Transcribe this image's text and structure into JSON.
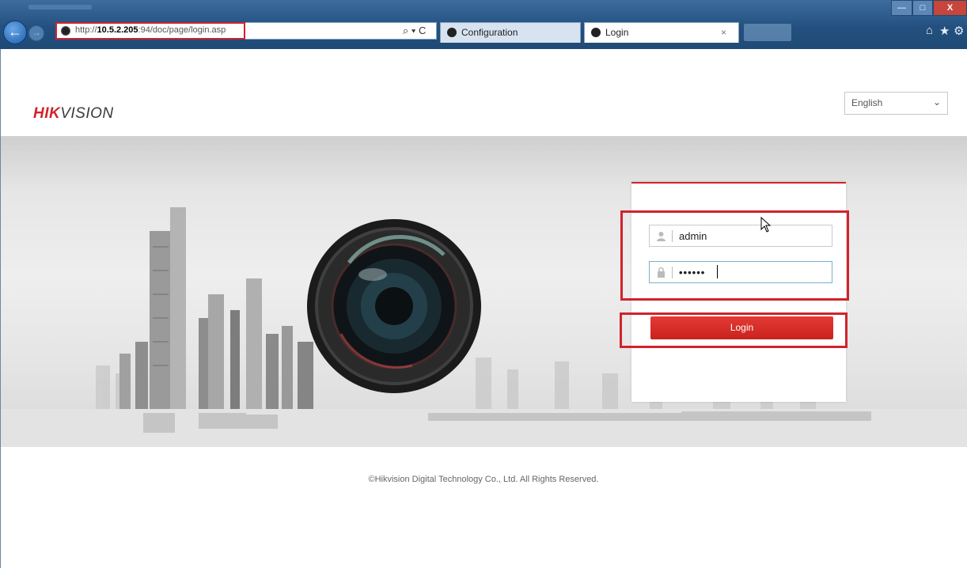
{
  "browser": {
    "address": {
      "prefix": "http://",
      "host": "10.5.2.205",
      "rest": ":94/doc/page/login.asp",
      "search_glyph": "⌕ ▾ C"
    },
    "tabs": [
      {
        "label": "Configuration"
      },
      {
        "label": "Login",
        "close": "×"
      }
    ],
    "window": {
      "minimize": "—",
      "maximize": "□",
      "close": "X"
    },
    "toolbar": {
      "home": "⌂",
      "star": "★",
      "gear": "⚙"
    },
    "nav": {
      "back": "←",
      "forward": "→"
    }
  },
  "page": {
    "logo": {
      "hik": "HIK",
      "vision": "VISION"
    },
    "language": {
      "selected": "English",
      "chevron": "⌄"
    },
    "login": {
      "username": "admin",
      "password_masked": "••••••",
      "button_label": "Login"
    },
    "footer": "©Hikvision Digital Technology Co., Ltd. All Rights Reserved."
  },
  "icons": {
    "user": "user-icon",
    "lock": "lock-icon",
    "cursor": "mouse-pointer-icon"
  },
  "colors": {
    "brand_red": "#d0232b",
    "button_red": "#e43a34",
    "chrome_blue": "#23507f"
  }
}
